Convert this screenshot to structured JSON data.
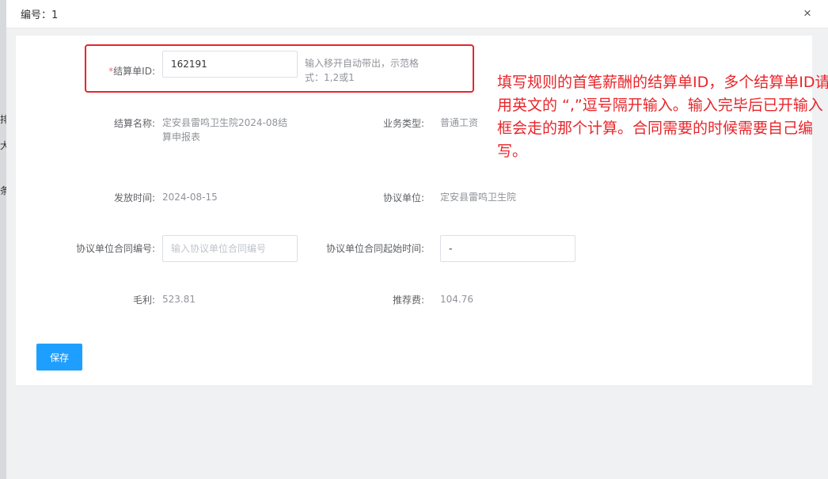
{
  "dialog": {
    "title": "编号：1",
    "close_glyph": "×"
  },
  "form": {
    "settlement_id": {
      "required_mark": "*",
      "label": "结算单ID:",
      "value": "162191",
      "hint": "输入移开自动带出，示范格式：1,2或1"
    },
    "settlement_name": {
      "label": "结算名称:",
      "value": "定安县雷鸣卫生院2024-08结算申报表"
    },
    "business_type": {
      "label": "业务类型:",
      "value": "普通工资"
    },
    "issue_date": {
      "label": "发放时间:",
      "value": "2024-08-15"
    },
    "agreement_unit": {
      "label": "协议单位:",
      "value": "定安县雷鸣卫生院"
    },
    "contract_no": {
      "label": "协议单位合同编号:",
      "placeholder": "输入协议单位合同编号"
    },
    "contract_start": {
      "label": "协议单位合同起始时间:",
      "value": "-"
    },
    "gross_profit": {
      "label": "毛利:",
      "value": "523.81"
    },
    "referral_fee": {
      "label": "推荐费:",
      "value": "104.76"
    },
    "save_label": "保存"
  },
  "annotation": {
    "text": "填写规则的首笔薪酬的结算单ID，多个结算单ID请用英文的 “,”逗号隔开输入。输入完毕后已开输入框会走的那个计算。合同需要的时候需要自己编写。"
  },
  "colors": {
    "primary": "#1e9fff",
    "annotation_red": "#e8252a",
    "required": "#f56c6c"
  }
}
